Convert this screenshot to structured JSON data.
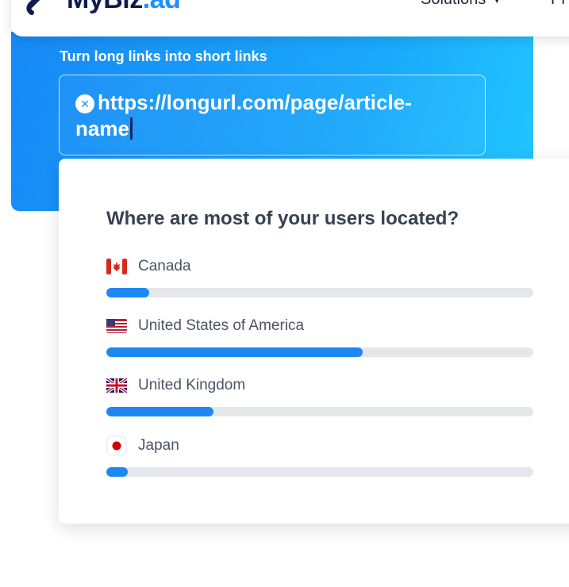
{
  "brand": {
    "name": "MyBiz",
    "tld": ".ad"
  },
  "nav": {
    "menu_label": "Solutions",
    "next_label_partial": "Pr"
  },
  "hero": {
    "label": "Turn long links into short links",
    "url_value": "https://longurl.com/page/article-name",
    "clear_icon": "close-circle-icon"
  },
  "card": {
    "title": "Where are most of your users located?",
    "locations": [
      {
        "name": "Canada",
        "flag": "canada-flag-icon",
        "share": 0.1
      },
      {
        "name": "United States of America",
        "flag": "us-flag-icon",
        "share": 0.6
      },
      {
        "name": "United Kingdom",
        "flag": "uk-flag-icon",
        "share": 0.25
      },
      {
        "name": "Japan",
        "flag": "japan-flag-icon",
        "share": 0.05
      }
    ]
  },
  "colors": {
    "accent": "#1e88f2",
    "track": "#e5e7eb",
    "hero_start": "#1689f5",
    "hero_end": "#22c6ff",
    "brand_dark": "#0f1b4c"
  }
}
